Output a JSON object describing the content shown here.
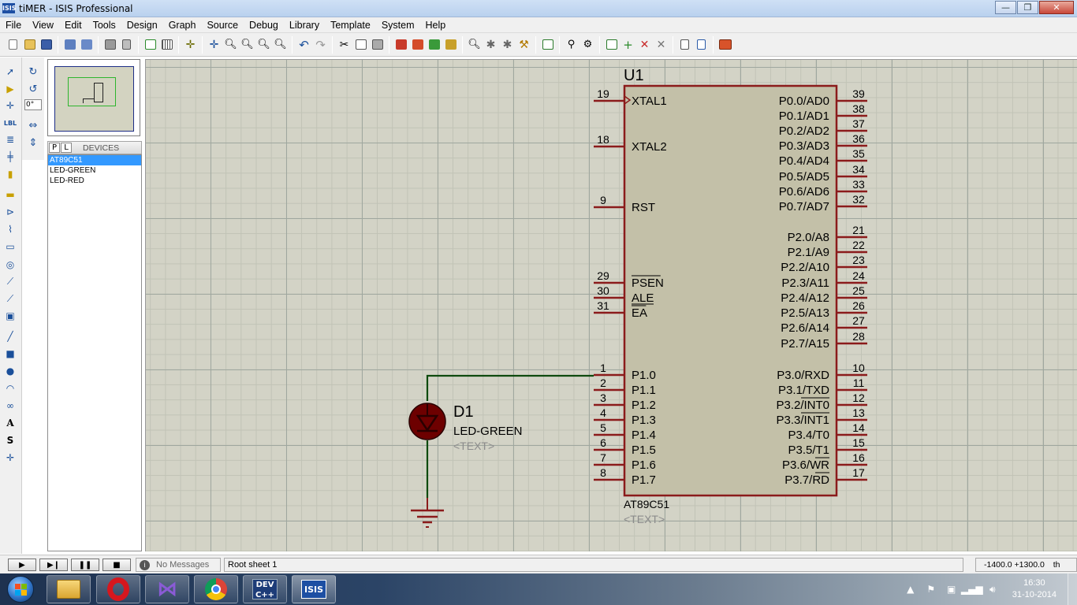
{
  "window": {
    "title": "tiMER - ISIS Professional",
    "app_icon_text": "ISIS",
    "minimize": "—",
    "maximize": "❐",
    "close": "✕"
  },
  "menu": [
    "File",
    "View",
    "Edit",
    "Tools",
    "Design",
    "Graph",
    "Source",
    "Debug",
    "Library",
    "Template",
    "System",
    "Help"
  ],
  "left_panel": {
    "angle_value": "0°",
    "tab_p": "P",
    "tab_l": "L",
    "devices_header": "DEVICES",
    "devices": [
      "AT89C51",
      "LED-GREEN",
      "LED-RED"
    ],
    "selected_device": "AT89C51"
  },
  "schematic": {
    "u1": {
      "ref": "U1",
      "part": "AT89C51",
      "text_placeholder": "<TEXT>",
      "left_pins": [
        {
          "num": "19",
          "name": "XTAL1"
        },
        {
          "num": "18",
          "name": "XTAL2"
        },
        {
          "num": "9",
          "name": "RST"
        },
        {
          "num": "29",
          "name": "PSEN"
        },
        {
          "num": "30",
          "name": "ALE"
        },
        {
          "num": "31",
          "name": "EA"
        },
        {
          "num": "1",
          "name": "P1.0"
        },
        {
          "num": "2",
          "name": "P1.1"
        },
        {
          "num": "3",
          "name": "P1.2"
        },
        {
          "num": "4",
          "name": "P1.3"
        },
        {
          "num": "5",
          "name": "P1.4"
        },
        {
          "num": "6",
          "name": "P1.5"
        },
        {
          "num": "7",
          "name": "P1.6"
        },
        {
          "num": "8",
          "name": "P1.7"
        }
      ],
      "right_pins": [
        {
          "num": "39",
          "name": "P0.0/AD0"
        },
        {
          "num": "38",
          "name": "P0.1/AD1"
        },
        {
          "num": "37",
          "name": "P0.2/AD2"
        },
        {
          "num": "36",
          "name": "P0.3/AD3"
        },
        {
          "num": "35",
          "name": "P0.4/AD4"
        },
        {
          "num": "34",
          "name": "P0.5/AD5"
        },
        {
          "num": "33",
          "name": "P0.6/AD6"
        },
        {
          "num": "32",
          "name": "P0.7/AD7"
        },
        {
          "num": "21",
          "name": "P2.0/A8"
        },
        {
          "num": "22",
          "name": "P2.1/A9"
        },
        {
          "num": "23",
          "name": "P2.2/A10"
        },
        {
          "num": "24",
          "name": "P2.3/A11"
        },
        {
          "num": "25",
          "name": "P2.4/A12"
        },
        {
          "num": "26",
          "name": "P2.5/A13"
        },
        {
          "num": "27",
          "name": "P2.6/A14"
        },
        {
          "num": "28",
          "name": "P2.7/A15"
        },
        {
          "num": "10",
          "name": "P3.0/RXD"
        },
        {
          "num": "11",
          "name": "P3.1/TXD"
        },
        {
          "num": "12",
          "name": "P3.2/INT0"
        },
        {
          "num": "13",
          "name": "P3.3/INT1"
        },
        {
          "num": "14",
          "name": "P3.4/T0"
        },
        {
          "num": "15",
          "name": "P3.5/T1"
        },
        {
          "num": "16",
          "name": "P3.6/WR"
        },
        {
          "num": "17",
          "name": "P3.7/RD"
        }
      ]
    },
    "d1": {
      "ref": "D1",
      "part": "LED-GREEN",
      "text_placeholder": "<TEXT>"
    }
  },
  "statusbar": {
    "messages": "No Messages",
    "sheet": "Root sheet 1",
    "coord_x": "-1400.0",
    "coord_y": "+1300.0",
    "units": "th"
  },
  "taskbar": {
    "time": "16:30",
    "date": "31-10-2014",
    "apps": [
      "file-explorer",
      "opera",
      "visual-studio",
      "chrome",
      "dev-cpp",
      "isis"
    ]
  },
  "colors": {
    "canvas": "#d3d3c6",
    "component_outline": "#8b1b1b",
    "wire": "#0e4a0e",
    "led_body": "#7a0000"
  }
}
